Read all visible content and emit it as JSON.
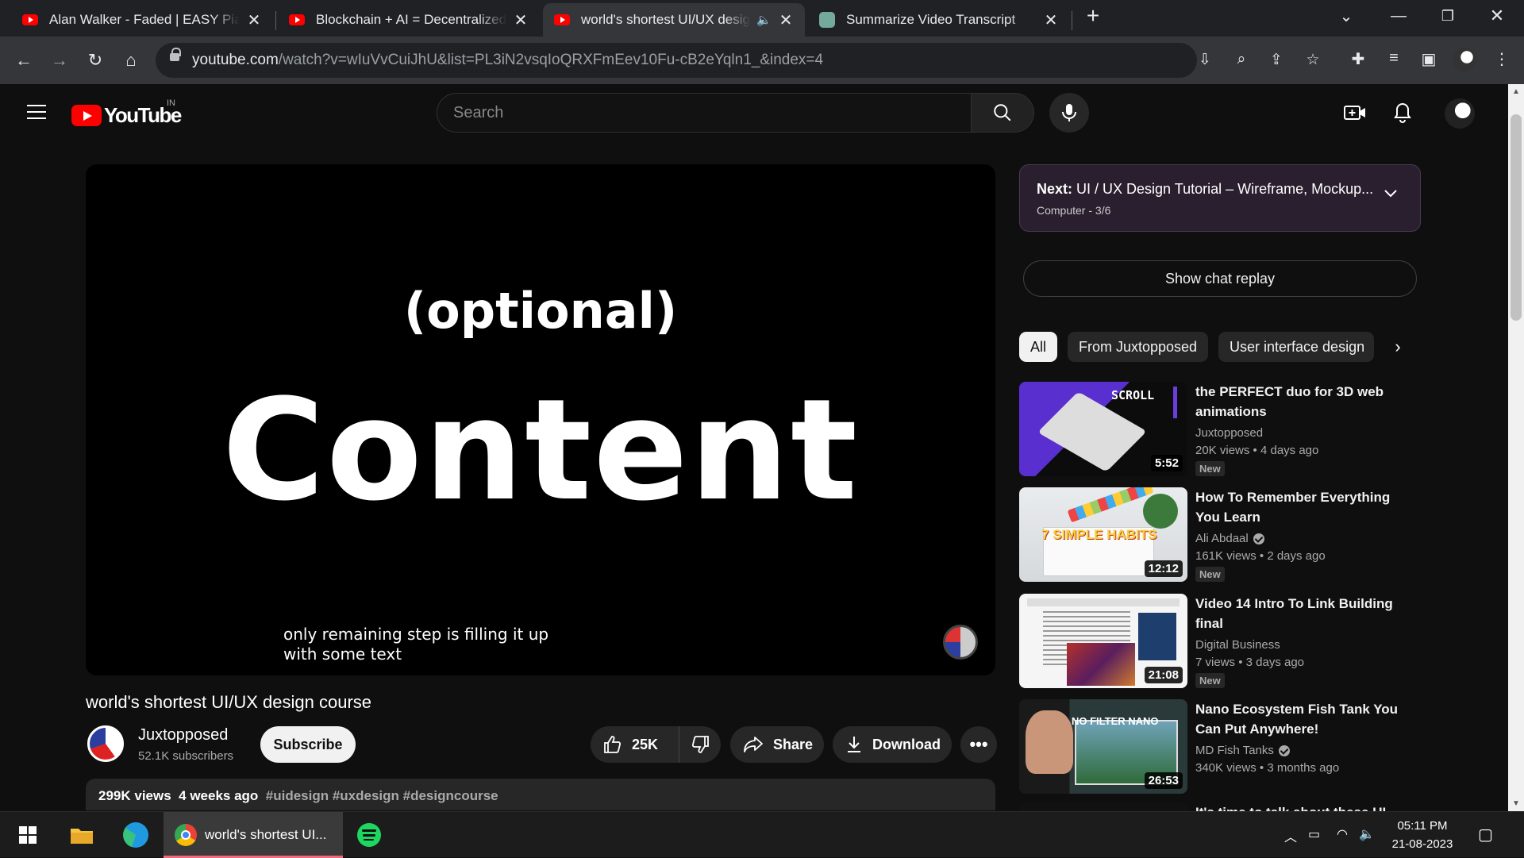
{
  "browser": {
    "tabs": [
      {
        "title": "Alan Walker - Faded | EASY Piano",
        "icon": "youtube-icon",
        "active": false
      },
      {
        "title": "Blockchain + AI = Decentralized AI",
        "icon": "youtube-icon",
        "active": false
      },
      {
        "title": "world's shortest UI/UX design course",
        "icon": "youtube-icon",
        "active": true,
        "audio": true
      },
      {
        "title": "Summarize Video Transcript",
        "icon": "chatgpt-icon",
        "active": false
      }
    ],
    "url_host": "youtube.com",
    "url_path": "/watch?v=wIuVvCuiJhU&list=PL3iN2vsqIoQRXFmEev10Fu-cB2eYqln1_&index=4"
  },
  "youtube": {
    "logo_text": "YouTube",
    "country_code": "IN",
    "search_placeholder": "Search"
  },
  "video": {
    "frame_text_top": "(optional)",
    "frame_text_main": "Content",
    "caption_line1": "only remaining step is filling it up",
    "caption_line2": "with some text",
    "title": "world's shortest UI/UX design course",
    "channel_name": "Juxtopposed",
    "subscribers": "52.1K subscribers",
    "subscribe_label": "Subscribe",
    "likes": "25K",
    "share_label": "Share",
    "download_label": "Download",
    "views": "299K views",
    "age": "4 weeks ago",
    "hashtags": "#uidesign #uxdesign #designcourse"
  },
  "sidebar": {
    "next_prefix": "Next:",
    "next_title": "UI / UX Design Tutorial – Wireframe, Mockup...",
    "playlist_info": "Computer - 3/6",
    "chat_replay_label": "Show chat replay",
    "chips": [
      "All",
      "From Juxtopposed",
      "User interface design"
    ],
    "recommendations": [
      {
        "title": "the PERFECT duo for 3D web animations",
        "channel": "Juxtopposed",
        "verified": false,
        "views": "20K views",
        "age": "4 days ago",
        "badge": "New",
        "duration": "5:52",
        "thumb_text": "SCROLL"
      },
      {
        "title": "How To Remember Everything You Learn",
        "channel": "Ali Abdaal",
        "verified": true,
        "views": "161K views",
        "age": "2 days ago",
        "badge": "New",
        "duration": "12:12",
        "thumb_text": "7 SIMPLE HABITS"
      },
      {
        "title": "Video 14 Intro To Link Building final",
        "channel": "Digital Business",
        "verified": false,
        "views": "7 views",
        "age": "3 days ago",
        "badge": "New",
        "duration": "21:08",
        "thumb_text": ""
      },
      {
        "title": "Nano Ecosystem Fish Tank You Can Put Anywhere!",
        "channel": "MD Fish Tanks",
        "verified": true,
        "views": "340K views",
        "age": "3 months ago",
        "badge": "",
        "duration": "26:53",
        "thumb_text": "NO FILTER NANO"
      },
      {
        "title": "It's time to talk about these UI",
        "channel": "",
        "verified": false,
        "views": "",
        "age": "",
        "badge": "",
        "duration": "",
        "thumb_text": ""
      }
    ]
  },
  "taskbar": {
    "chrome_window_title": "world's shortest UI...",
    "time": "05:11 PM",
    "date": "21-08-2023"
  }
}
